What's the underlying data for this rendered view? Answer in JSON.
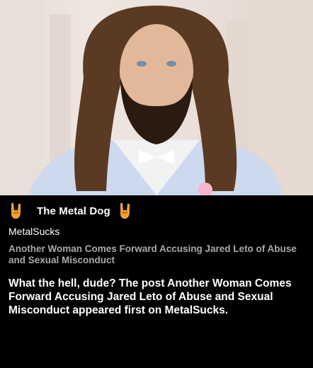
{
  "card": {
    "source_title": "The Metal Dog",
    "site_name": "MetalSucks",
    "headline": "Another Woman Comes Forward Accusing Jared Leto of Abuse and Sexual Misconduct",
    "body": "What the hell, dude? The post Another Woman Comes Forward Accusing Jared Leto of Abuse and Sexual Misconduct appeared first on MetalSucks.",
    "icons": [
      "rock-hand-icon",
      "rock-hand-icon"
    ]
  },
  "colors": {
    "background": "#000000",
    "headline": "#a9a9a9",
    "text": "#ffffff",
    "icon": "#f0a030"
  }
}
